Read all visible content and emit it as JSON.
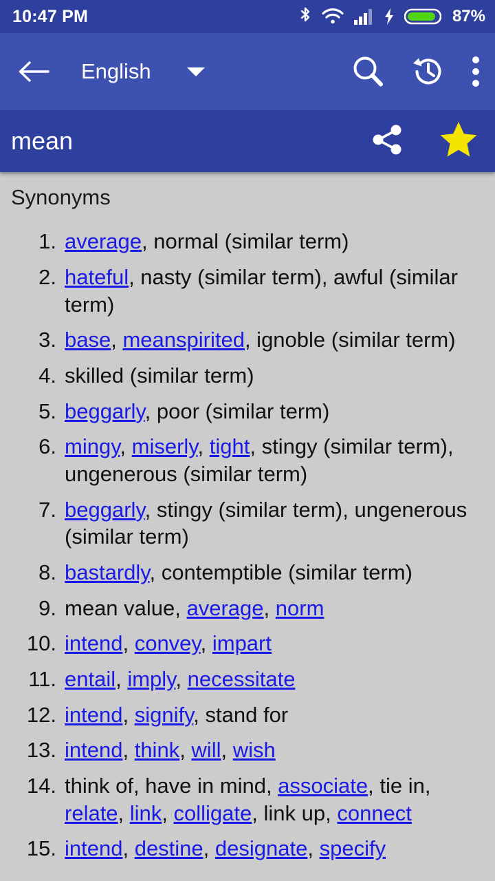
{
  "status_bar": {
    "time": "10:47 PM",
    "battery_percent": "87%",
    "icons": [
      "bluetooth-icon",
      "wifi-icon",
      "cellular-signal-icon",
      "charging-bolt-icon",
      "battery-icon"
    ],
    "background_color": "#2f3f9e",
    "battery_fill_color": "#4fd412"
  },
  "app_bar": {
    "back_label": "back-arrow",
    "language": "English",
    "dropdown": "caret-down",
    "search_label": "search",
    "history_label": "history",
    "overflow_label": "more options",
    "background_color": "#3d51b0"
  },
  "word_bar": {
    "word": "mean",
    "share_label": "share",
    "favorite_label": "favorite",
    "favorited": true,
    "star_color": "#f5e400",
    "background_color": "#2f3f9e"
  },
  "content": {
    "section_title": "Synonyms",
    "background_color": "#cccccc",
    "link_color": "#1a1ae6",
    "entries": [
      {
        "num": "1.",
        "parts": [
          {
            "t": "link",
            "v": "average"
          },
          {
            "t": "text",
            "v": ", normal (similar term)"
          }
        ]
      },
      {
        "num": "2.",
        "parts": [
          {
            "t": "link",
            "v": "hateful"
          },
          {
            "t": "text",
            "v": ", nasty (similar term), awful (similar term)"
          }
        ]
      },
      {
        "num": "3.",
        "parts": [
          {
            "t": "link",
            "v": "base"
          },
          {
            "t": "text",
            "v": ", "
          },
          {
            "t": "link",
            "v": "meanspirited"
          },
          {
            "t": "text",
            "v": ", ignoble (similar term)"
          }
        ]
      },
      {
        "num": "4.",
        "parts": [
          {
            "t": "text",
            "v": "skilled (similar term)"
          }
        ]
      },
      {
        "num": "5.",
        "parts": [
          {
            "t": "link",
            "v": "beggarly"
          },
          {
            "t": "text",
            "v": ", poor (similar term)"
          }
        ]
      },
      {
        "num": "6.",
        "parts": [
          {
            "t": "link",
            "v": "mingy"
          },
          {
            "t": "text",
            "v": ", "
          },
          {
            "t": "link",
            "v": "miserly"
          },
          {
            "t": "text",
            "v": ", "
          },
          {
            "t": "link",
            "v": "tight"
          },
          {
            "t": "text",
            "v": ", stingy (similar term), ungenerous (similar term)"
          }
        ]
      },
      {
        "num": "7.",
        "parts": [
          {
            "t": "link",
            "v": "beggarly"
          },
          {
            "t": "text",
            "v": ", stingy (similar term), ungenerous (similar term)"
          }
        ]
      },
      {
        "num": "8.",
        "parts": [
          {
            "t": "link",
            "v": "bastardly"
          },
          {
            "t": "text",
            "v": ", contemptible (similar term)"
          }
        ]
      },
      {
        "num": "9.",
        "parts": [
          {
            "t": "text",
            "v": "mean value, "
          },
          {
            "t": "link",
            "v": "average"
          },
          {
            "t": "text",
            "v": ", "
          },
          {
            "t": "link",
            "v": "norm"
          }
        ]
      },
      {
        "num": "10.",
        "parts": [
          {
            "t": "link",
            "v": "intend"
          },
          {
            "t": "text",
            "v": ", "
          },
          {
            "t": "link",
            "v": "convey"
          },
          {
            "t": "text",
            "v": ", "
          },
          {
            "t": "link",
            "v": "impart"
          }
        ]
      },
      {
        "num": "11.",
        "parts": [
          {
            "t": "link",
            "v": "entail"
          },
          {
            "t": "text",
            "v": ", "
          },
          {
            "t": "link",
            "v": "imply"
          },
          {
            "t": "text",
            "v": ", "
          },
          {
            "t": "link",
            "v": "necessitate"
          }
        ]
      },
      {
        "num": "12.",
        "parts": [
          {
            "t": "link",
            "v": "intend"
          },
          {
            "t": "text",
            "v": ", "
          },
          {
            "t": "link",
            "v": "signify"
          },
          {
            "t": "text",
            "v": ", stand for"
          }
        ]
      },
      {
        "num": "13.",
        "parts": [
          {
            "t": "link",
            "v": "intend"
          },
          {
            "t": "text",
            "v": ", "
          },
          {
            "t": "link",
            "v": "think"
          },
          {
            "t": "text",
            "v": ", "
          },
          {
            "t": "link",
            "v": "will"
          },
          {
            "t": "text",
            "v": ", "
          },
          {
            "t": "link",
            "v": "wish"
          }
        ]
      },
      {
        "num": "14.",
        "parts": [
          {
            "t": "text",
            "v": "think of, have in mind, "
          },
          {
            "t": "link",
            "v": "associate"
          },
          {
            "t": "text",
            "v": ", tie in, "
          },
          {
            "t": "link",
            "v": "relate"
          },
          {
            "t": "text",
            "v": ", "
          },
          {
            "t": "link",
            "v": "link"
          },
          {
            "t": "text",
            "v": ", "
          },
          {
            "t": "link",
            "v": "colligate"
          },
          {
            "t": "text",
            "v": ", link up, "
          },
          {
            "t": "link",
            "v": "connect"
          }
        ]
      },
      {
        "num": "15.",
        "parts": [
          {
            "t": "link",
            "v": "intend"
          },
          {
            "t": "text",
            "v": ", "
          },
          {
            "t": "link",
            "v": "destine"
          },
          {
            "t": "text",
            "v": ", "
          },
          {
            "t": "link",
            "v": "designate"
          },
          {
            "t": "text",
            "v": ", "
          },
          {
            "t": "link",
            "v": "specify"
          }
        ]
      }
    ]
  }
}
